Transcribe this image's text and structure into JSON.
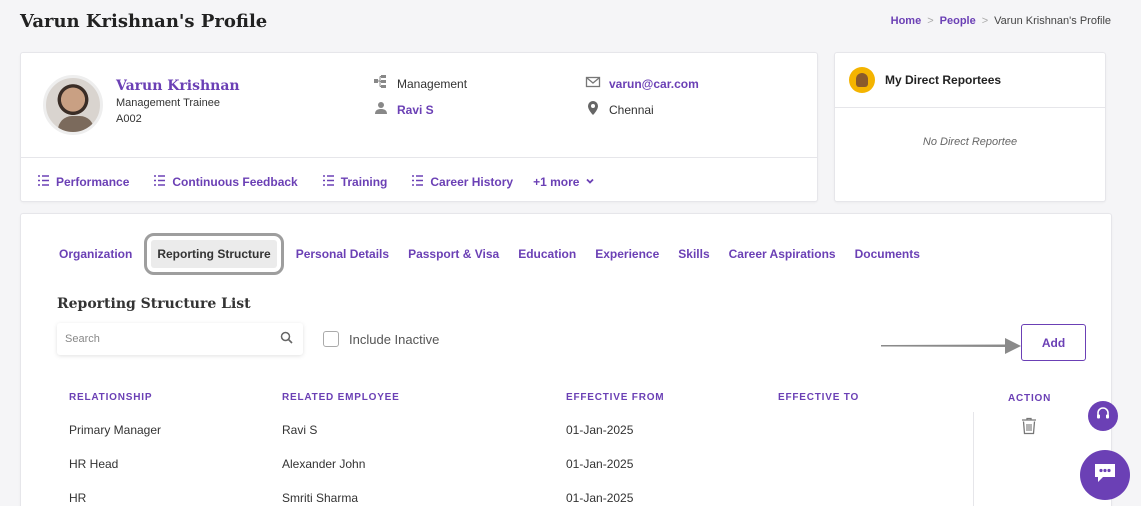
{
  "page": {
    "title": "Varun Krishnan's Profile"
  },
  "breadcrumb": {
    "home": "Home",
    "people": "People",
    "current": "Varun Krishnan's Profile",
    "separator": ">"
  },
  "profile": {
    "name": "Varun Krishnan",
    "designation": "Management Trainee",
    "code": "A002",
    "department": "Management",
    "manager": "Ravi S",
    "email": "varun@car.com",
    "location": "Chennai"
  },
  "quick_tabs": [
    "Performance",
    "Continuous Feedback",
    "Training",
    "Career History",
    "+1 more"
  ],
  "reportees": {
    "title": "My Direct Reportees",
    "empty_text": "No Direct Reportee"
  },
  "tabs": [
    "Organization",
    "Reporting Structure",
    "Personal Details",
    "Passport & Visa",
    "Education",
    "Experience",
    "Skills",
    "Career Aspirations",
    "Documents"
  ],
  "active_tab": "Reporting Structure",
  "reporting": {
    "title": "Reporting Structure List",
    "search_placeholder": "Search",
    "include_inactive_label": "Include Inactive",
    "add_label": "Add",
    "columns": {
      "relationship": "RELATIONSHIP",
      "related_employee": "RELATED EMPLOYEE",
      "effective_from": "EFFECTIVE FROM",
      "effective_to": "EFFECTIVE TO",
      "action": "ACTION"
    },
    "rows": [
      {
        "relationship": "Primary Manager",
        "employee": "Ravi S",
        "from": "01-Jan-2025",
        "to": ""
      },
      {
        "relationship": "HR Head",
        "employee": "Alexander John",
        "from": "01-Jan-2025",
        "to": ""
      },
      {
        "relationship": "HR",
        "employee": "Smriti Sharma",
        "from": "01-Jan-2025",
        "to": ""
      }
    ]
  },
  "colors": {
    "accent": "#6b40b5",
    "highlight_outline": "#9e9e9e"
  }
}
